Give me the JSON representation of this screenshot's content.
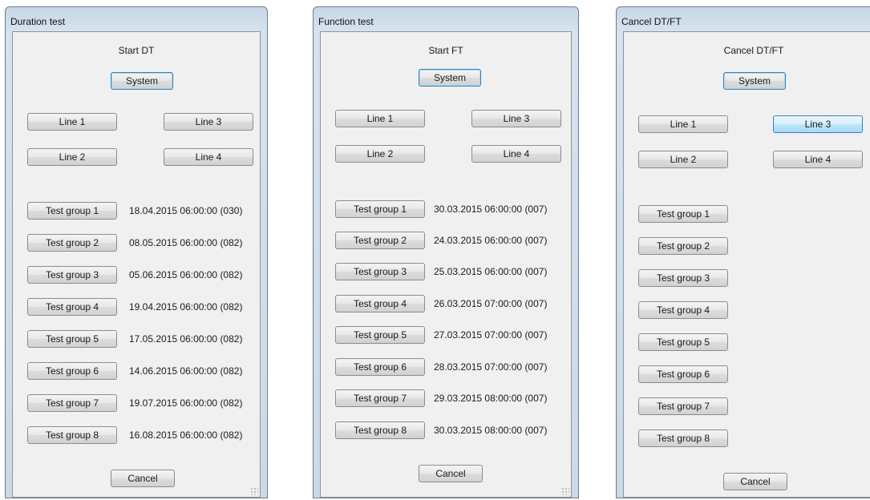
{
  "windows": [
    {
      "title": "Duration test",
      "heading": "Start DT",
      "system_label": "System",
      "lines": {
        "line1": "Line 1",
        "line2": "Line 2",
        "line3": "Line 3",
        "line4": "Line 4"
      },
      "groups": [
        {
          "label": "Test group 1",
          "date": "18.04.2015 06:00:00 (030)"
        },
        {
          "label": "Test group 2",
          "date": "08.05.2015 06:00:00 (082)"
        },
        {
          "label": "Test group 3",
          "date": "05.06.2015 06:00:00 (082)"
        },
        {
          "label": "Test group 4",
          "date": "19.04.2015 06:00:00 (082)"
        },
        {
          "label": "Test group 5",
          "date": "17.05.2015 06:00:00 (082)"
        },
        {
          "label": "Test group 6",
          "date": "14.06.2015 06:00:00 (082)"
        },
        {
          "label": "Test group 7",
          "date": "19.07.2015 06:00:00 (082)"
        },
        {
          "label": "Test group 8",
          "date": "16.08.2015 06:00:00 (082)"
        }
      ],
      "cancel_label": "Cancel"
    },
    {
      "title": "Function test",
      "heading": "Start FT",
      "system_label": "System",
      "lines": {
        "line1": "Line 1",
        "line2": "Line 2",
        "line3": "Line 3",
        "line4": "Line 4"
      },
      "groups": [
        {
          "label": "Test group 1",
          "date": "30.03.2015 06:00:00 (007)"
        },
        {
          "label": "Test group 2",
          "date": "24.03.2015 06:00:00 (007)"
        },
        {
          "label": "Test group 3",
          "date": "25.03.2015 06:00:00 (007)"
        },
        {
          "label": "Test group 4",
          "date": "26.03.2015 07:00:00 (007)"
        },
        {
          "label": "Test group 5",
          "date": "27.03.2015 07:00:00 (007)"
        },
        {
          "label": "Test group 6",
          "date": "28.03.2015 07:00:00 (007)"
        },
        {
          "label": "Test group 7",
          "date": "29.03.2015 08:00:00 (007)"
        },
        {
          "label": "Test group 8",
          "date": "30.03.2015 08:00:00 (007)"
        }
      ],
      "cancel_label": "Cancel"
    },
    {
      "title": "Cancel DT/FT",
      "heading": "Cancel DT/FT",
      "system_label": "System",
      "lines": {
        "line1": "Line 1",
        "line2": "Line 2",
        "line3": "Line 3",
        "line4": "Line 4"
      },
      "groups": [
        {
          "label": "Test group 1"
        },
        {
          "label": "Test group 2"
        },
        {
          "label": "Test group 3"
        },
        {
          "label": "Test group 4"
        },
        {
          "label": "Test group 5"
        },
        {
          "label": "Test group 6"
        },
        {
          "label": "Test group 7"
        },
        {
          "label": "Test group 8"
        }
      ],
      "cancel_label": "Cancel"
    }
  ],
  "colors": {
    "titlebar": "#cfdbe8",
    "client_bg": "#f0f0f0",
    "hot_button": "#bee6fd",
    "focus_border": "#3c7fb1"
  }
}
